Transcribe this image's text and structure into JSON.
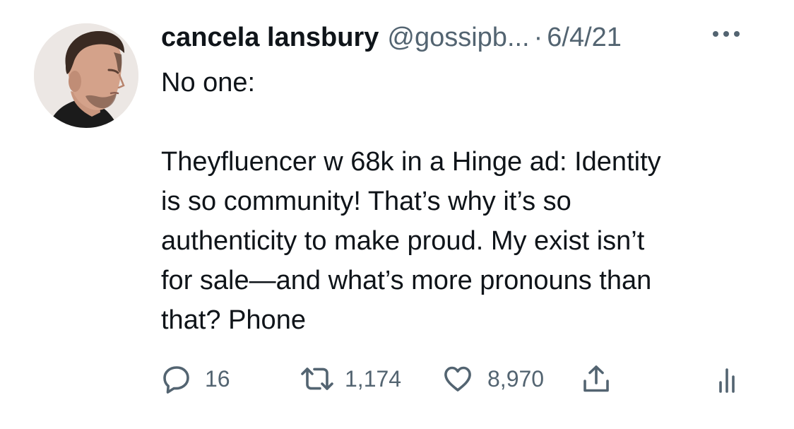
{
  "tweet": {
    "display_name": "cancela lansbury",
    "handle": "@gossipb...",
    "separator": "·",
    "date": "6/4/21",
    "text": "No one:\n\nTheyfluencer w 68k in a Hinge ad: Identity\nis so community! That’s why it’s so\nauthenticity to make proud. My exist isn’t\nfor sale—and what’s more pronouns than\nthat? Phone",
    "more_icon": "more-horizontal-icon",
    "avatar_icon": "profile-photo"
  },
  "actions": {
    "reply": {
      "icon": "reply-icon",
      "count": "16"
    },
    "retweet": {
      "icon": "retweet-icon",
      "count": "1,174"
    },
    "like": {
      "icon": "heart-icon",
      "count": "8,970"
    },
    "share": {
      "icon": "share-icon"
    },
    "analytics": {
      "icon": "analytics-icon"
    }
  },
  "colors": {
    "text_primary": "#0f1419",
    "text_secondary": "#536471",
    "background": "#ffffff"
  }
}
